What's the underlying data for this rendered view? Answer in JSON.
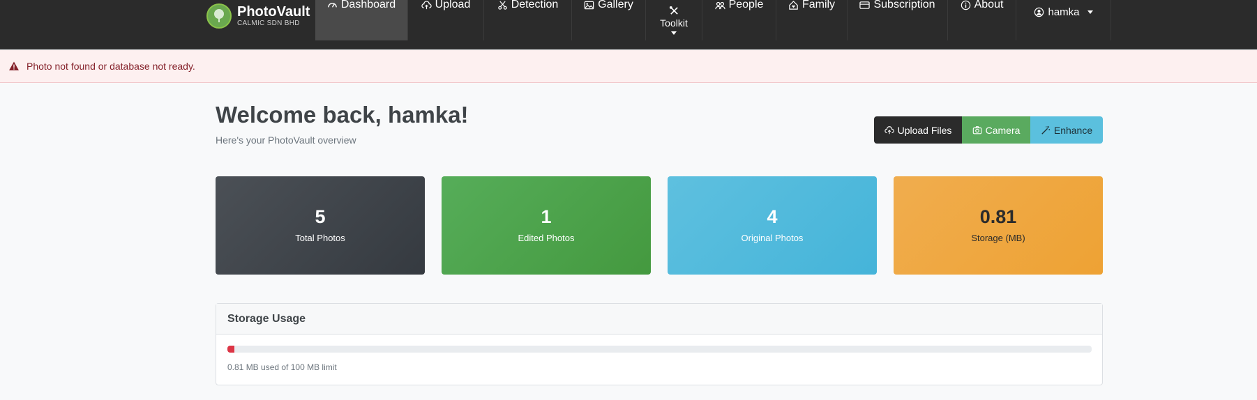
{
  "navbar": {
    "brand_name": "PhotoVault",
    "brand_sub": "CALMIC SDN BHD",
    "items": [
      {
        "label": "Dashboard",
        "icon": "gauge-icon",
        "active": true
      },
      {
        "label": "Upload",
        "icon": "cloud-upload-icon"
      },
      {
        "label": "Detection",
        "icon": "scissors-icon"
      },
      {
        "label": "Gallery",
        "icon": "image-icon"
      },
      {
        "label": "Toolkit",
        "icon": "tools-icon"
      },
      {
        "label": "People",
        "icon": "people-icon"
      },
      {
        "label": "Family",
        "icon": "house-heart-icon"
      },
      {
        "label": "Subscription",
        "icon": "credit-card-icon"
      },
      {
        "label": "About",
        "icon": "info-circle-icon"
      }
    ],
    "user": "hamka"
  },
  "alert": {
    "message": "Photo not found or database not ready.",
    "icon": "warning-triangle-icon"
  },
  "header": {
    "welcome": "Welcome back, hamka!",
    "subtitle": "Here's your PhotoVault overview"
  },
  "actions": {
    "upload": "Upload Files",
    "camera": "Camera",
    "enhance": "Enhance"
  },
  "stats": [
    {
      "value": "5",
      "label": "Total Photos"
    },
    {
      "value": "1",
      "label": "Edited Photos"
    },
    {
      "value": "4",
      "label": "Original Photos"
    },
    {
      "value": "0.81",
      "label": "Storage (MB)"
    }
  ],
  "storage": {
    "title": "Storage Usage",
    "usage_text": "0.81 MB used of 100 MB limit",
    "percent_used": 0.81
  },
  "colors": {
    "navbar_bg": "#2b2b2b",
    "alert_text": "#842029",
    "stat_total": "#3f444a",
    "stat_edited": "#4caf50",
    "stat_original": "#5bc0de",
    "stat_storage": "#f0ad4e",
    "progress_fill": "#dc3545"
  }
}
